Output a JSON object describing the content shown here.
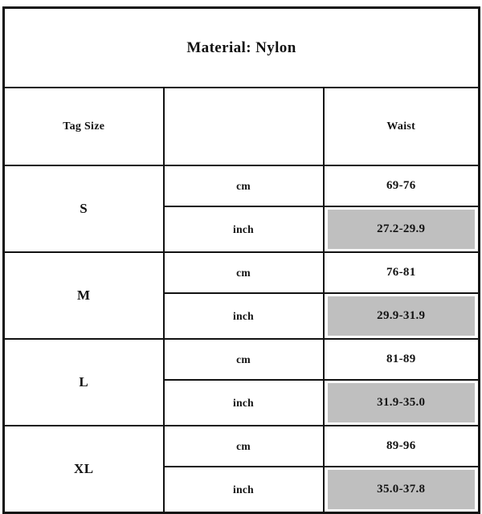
{
  "chart_data": {
    "type": "table",
    "title": "Material: Nylon",
    "columns": [
      "Tag Size",
      "",
      "Waist"
    ],
    "units": [
      "cm",
      "inch"
    ],
    "rows": [
      {
        "tag_size": "S",
        "cm": "69-76",
        "inch": "27.2-29.9"
      },
      {
        "tag_size": "M",
        "cm": "76-81",
        "inch": "29.9-31.9"
      },
      {
        "tag_size": "L",
        "cm": "81-89",
        "inch": "31.9-35.0"
      },
      {
        "tag_size": "XL",
        "cm": "89-96",
        "inch": "35.0-37.8"
      }
    ],
    "highlight_color": "#bfbfbf",
    "border_color": "#121212",
    "background_color": "#ffffff"
  },
  "table": {
    "title": "Material: Nylon",
    "header": {
      "tag_size": "Tag Size",
      "middle": "",
      "waist": "Waist"
    },
    "unit_labels": {
      "cm": "cm",
      "inch": "inch"
    },
    "sizes": [
      {
        "label": "S",
        "cm_label": "cm",
        "cm_value": "69-76",
        "inch_label": "inch",
        "inch_value": "27.2-29.9"
      },
      {
        "label": "M",
        "cm_label": "cm",
        "cm_value": "76-81",
        "inch_label": "inch",
        "inch_value": "29.9-31.9"
      },
      {
        "label": "L",
        "cm_label": "cm",
        "cm_value": "81-89",
        "inch_label": "inch",
        "inch_value": "31.9-35.0"
      },
      {
        "label": "XL",
        "cm_label": "cm",
        "cm_value": "89-96",
        "inch_label": "inch",
        "inch_value": "35.0-37.8"
      }
    ]
  }
}
